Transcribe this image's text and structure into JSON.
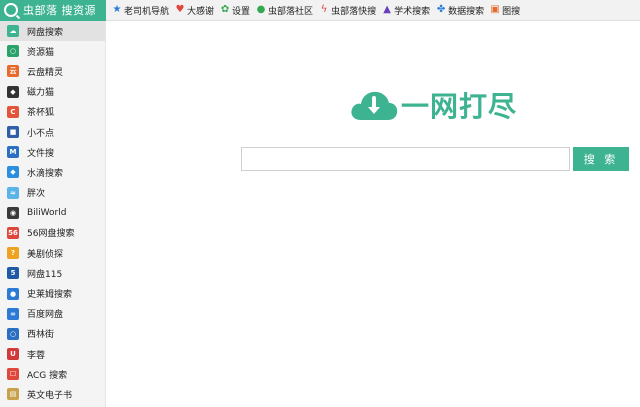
{
  "topbar": {
    "brand_text": "虫部落 搜资源",
    "nav": [
      {
        "label": "老司机导航",
        "icon": "star-icon",
        "color": "#2b7bd6"
      },
      {
        "label": "大感谢",
        "icon": "heart-icon",
        "color": "#e0473c"
      },
      {
        "label": "设置",
        "icon": "gear-icon",
        "color": "#34a853"
      },
      {
        "label": "虫部落社区",
        "icon": "chat-icon",
        "color": "#34a853"
      },
      {
        "label": "虫部落快搜",
        "icon": "lightning-icon",
        "color": "#e0473c"
      },
      {
        "label": "学术搜索",
        "icon": "graduation-cap-icon",
        "color": "#6a3fbf"
      },
      {
        "label": "数据搜索",
        "icon": "data-cluster-icon",
        "color": "#2b7bd6"
      },
      {
        "label": "图搜",
        "icon": "image-icon",
        "color": "#e66a2c"
      }
    ]
  },
  "sidebar": {
    "items": [
      {
        "label": "网盘搜索",
        "icon": "cloud-icon",
        "color": "#3eb391",
        "active": true
      },
      {
        "label": "资源猫",
        "icon": "search-cat-icon",
        "color": "#2aa36a"
      },
      {
        "label": "云盘精灵",
        "icon": "cloud-sprite-icon",
        "color": "#e8692c"
      },
      {
        "label": "磁力猫",
        "icon": "cat-icon",
        "color": "#333333"
      },
      {
        "label": "茶杯狐",
        "icon": "teacup-fox-icon",
        "color": "#e2553a"
      },
      {
        "label": "小不点",
        "icon": "dot-icon",
        "color": "#2e5ea8"
      },
      {
        "label": "文件搜",
        "icon": "file-search-icon",
        "color": "#2b6fc2"
      },
      {
        "label": "水滴搜索",
        "icon": "water-drop-icon",
        "color": "#2b8fe0"
      },
      {
        "label": "胖次",
        "icon": "pants-icon",
        "color": "#5ab4e8"
      },
      {
        "label": "BiliWorld",
        "icon": "biliworld-icon",
        "color": "#3a3a3a"
      },
      {
        "label": "56网盘搜索",
        "icon": "badge-56-icon",
        "color": "#e0473c"
      },
      {
        "label": "美剧侦探",
        "icon": "detective-icon",
        "color": "#f0a21e"
      },
      {
        "label": "网盘115",
        "icon": "badge-5-icon",
        "color": "#1f5aa6"
      },
      {
        "label": "史莱姆搜索",
        "icon": "slime-icon",
        "color": "#2b7bd6"
      },
      {
        "label": "百度网盘",
        "icon": "baidu-cloud-icon",
        "color": "#2b7bd6"
      },
      {
        "label": "西林街",
        "icon": "ring-icon",
        "color": "#2b6fc2"
      },
      {
        "label": "李蓉",
        "icon": "magnet-icon",
        "color": "#d23a3a"
      },
      {
        "label": "ACG 搜索",
        "icon": "acg-icon",
        "color": "#e0473c"
      },
      {
        "label": "英文电子书",
        "icon": "book-icon",
        "color": "#c8a24a"
      }
    ]
  },
  "main": {
    "logo_text": "一网打尽",
    "search_placeholder": "",
    "search_value": "",
    "search_button": "搜 索",
    "accent_color": "#3eb391"
  }
}
